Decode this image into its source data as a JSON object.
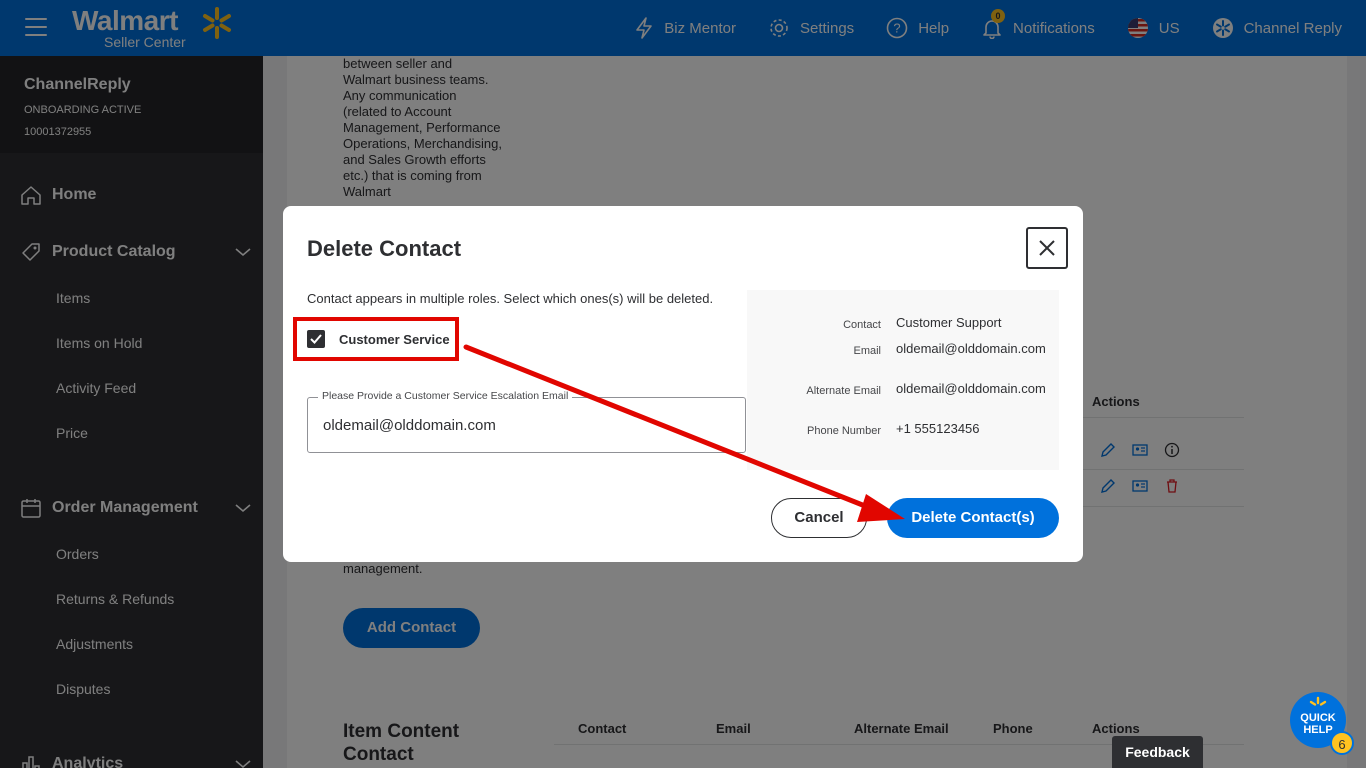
{
  "topbar": {
    "logo_brand": "Walmart",
    "logo_sub": "Seller Center",
    "biz_mentor": "Biz Mentor",
    "settings": "Settings",
    "help": "Help",
    "notifications": "Notifications",
    "notifications_count": "0",
    "country": "US",
    "account": "Channel Reply"
  },
  "sidebar": {
    "seller_name": "ChannelReply",
    "seller_status": "ONBOARDING ACTIVE",
    "seller_id": "10001372955",
    "home": "Home",
    "product_catalog": "Product Catalog",
    "catalog_items": [
      "Items",
      "Items on Hold",
      "Activity Feed",
      "Price"
    ],
    "order_management": "Order Management",
    "order_items": [
      "Orders",
      "Returns & Refunds",
      "Adjustments",
      "Disputes"
    ],
    "analytics": "Analytics"
  },
  "main": {
    "description": "between seller and Walmart business teams. Any communication (related to Account Management, Performance Operations, Merchandising, and Sales Growth efforts etc.) that is coming from Walmart",
    "description_tail": "management.",
    "actions_header": "Actions",
    "add_contact": "Add Contact",
    "item_content_title": "Item Content Contact",
    "table_headers": [
      "Contact",
      "Email",
      "Alternate Email",
      "Phone",
      "Actions"
    ]
  },
  "modal": {
    "title": "Delete Contact",
    "message": "Contact appears in multiple roles. Select which ones(s) will be deleted.",
    "checkbox_label": "Customer Service",
    "checkbox_checked": true,
    "field_label": "Please Provide a Customer Service Escalation Email",
    "field_value": "oldemail@olddomain.com",
    "info": {
      "contact_label": "Contact",
      "contact_value": "Customer Support",
      "email_label": "Email",
      "email_value": "oldemail@olddomain.com",
      "alt_email_label": "Alternate Email",
      "alt_email_value": "oldemail@olddomain.com",
      "phone_label": "Phone Number",
      "phone_value": "+1 555123456"
    },
    "cancel": "Cancel",
    "delete": "Delete Contact(s)"
  },
  "footer": {
    "feedback": "Feedback",
    "quick_help_1": "QUICK",
    "quick_help_2": "HELP",
    "quick_help_count": "6"
  },
  "colors": {
    "primary": "#0071dc",
    "annotation": "#e10600",
    "sidebar": "#2e2f32"
  }
}
